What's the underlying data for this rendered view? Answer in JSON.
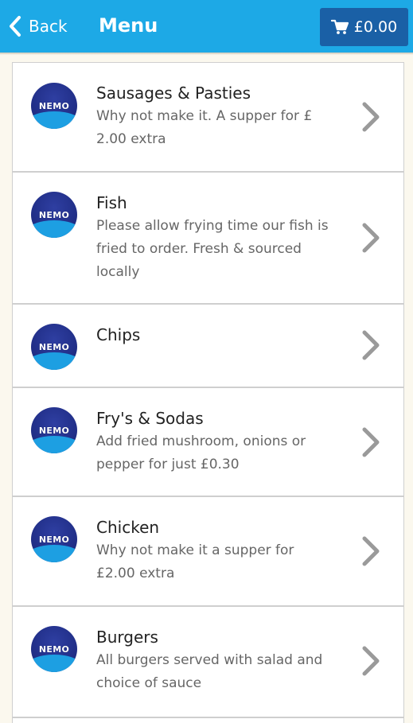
{
  "header": {
    "back_label": "Back",
    "title": "Menu",
    "cart_total": "£0.00"
  },
  "colors": {
    "header_bg": "#1da9e6",
    "cart_bg": "#1a60a6",
    "page_bg": "#fbf8ee"
  },
  "menu": {
    "logo_text": "NEMO",
    "categories": [
      {
        "title": "Sausages & Pasties",
        "description": "Why not make it. A supper for £ 2.00 extra"
      },
      {
        "title": "Fish",
        "description": "Please allow frying time our fish is fried to order. Fresh & sourced locally"
      },
      {
        "title": "Chips",
        "description": ""
      },
      {
        "title": "Fry's & Sodas",
        "description": "Add fried mushroom, onions or pepper for just £0.30"
      },
      {
        "title": "Chicken",
        "description": "Why not make it a supper for £2.00 extra"
      },
      {
        "title": "Burgers",
        "description": "All burgers served with salad and choice of sauce"
      }
    ]
  }
}
